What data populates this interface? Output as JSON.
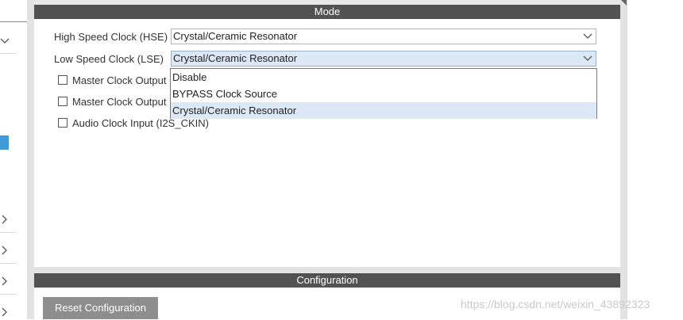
{
  "mode_panel": {
    "title": "Mode",
    "hse": {
      "label": "High Speed Clock (HSE)",
      "value": "Crystal/Ceramic Resonator"
    },
    "lse": {
      "label": "Low Speed Clock (LSE)",
      "value": "Crystal/Ceramic Resonator"
    },
    "dropdown_options": [
      "Disable",
      "BYPASS Clock Source",
      "Crystal/Ceramic Resonator"
    ],
    "dropdown_selected": "Crystal/Ceramic Resonator",
    "checkboxes": [
      {
        "label": "Master Clock Output",
        "checked": false
      },
      {
        "label": "Master Clock Output",
        "checked": false
      },
      {
        "label": "Audio Clock Input (I2S_CKIN)",
        "checked": false
      }
    ]
  },
  "config_panel": {
    "title": "Configuration",
    "reset_button": "Reset Configuration"
  },
  "watermark": "https://blog.csdn.net/weixin_43892323",
  "colors": {
    "header_bg": "#525252",
    "selected_bg": "#dce8f5",
    "accent_blue": "#3e9bd8",
    "button_bg": "#8e8e8e"
  }
}
